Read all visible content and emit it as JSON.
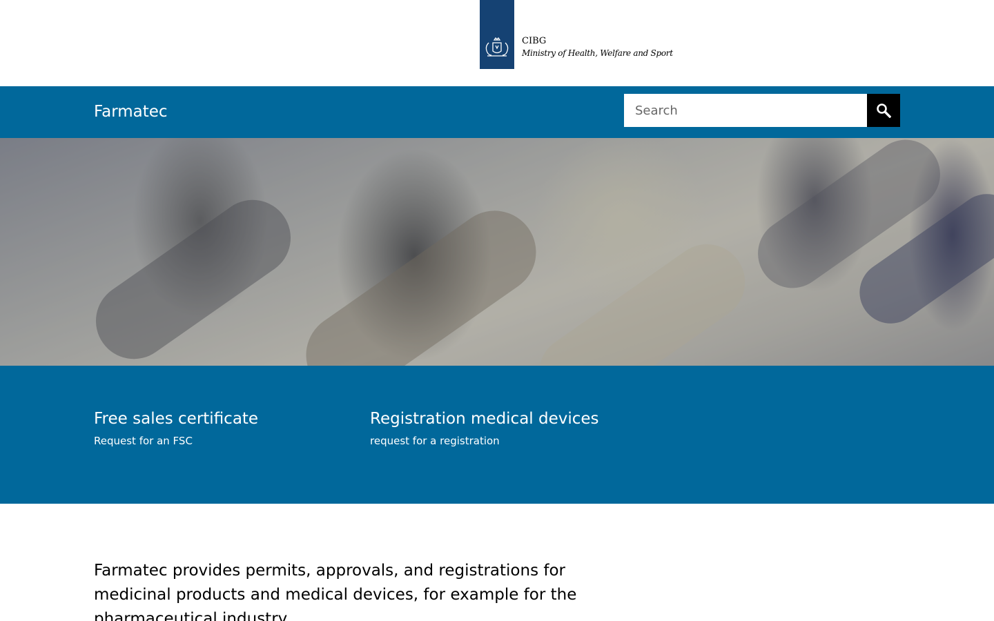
{
  "header": {
    "organization": "CIBG",
    "ministry": "Ministry of Health, Welfare and Sport",
    "logo_icon": "dutch-coat-of-arms-icon",
    "logo_color": "#154273"
  },
  "nav": {
    "site_name": "Farmatec",
    "search_placeholder": "Search",
    "search_icon": "search-icon",
    "bar_color": "#01689b"
  },
  "links": [
    {
      "title": "Free sales certificate",
      "subtitle": "Request for an FSC"
    },
    {
      "title": "Registration medical devices",
      "subtitle": "request for a registration"
    }
  ],
  "intro": {
    "text": "Farmatec provides permits, approvals, and registrations for medicinal products and medical devices, for example for the pharmaceutical industry."
  }
}
